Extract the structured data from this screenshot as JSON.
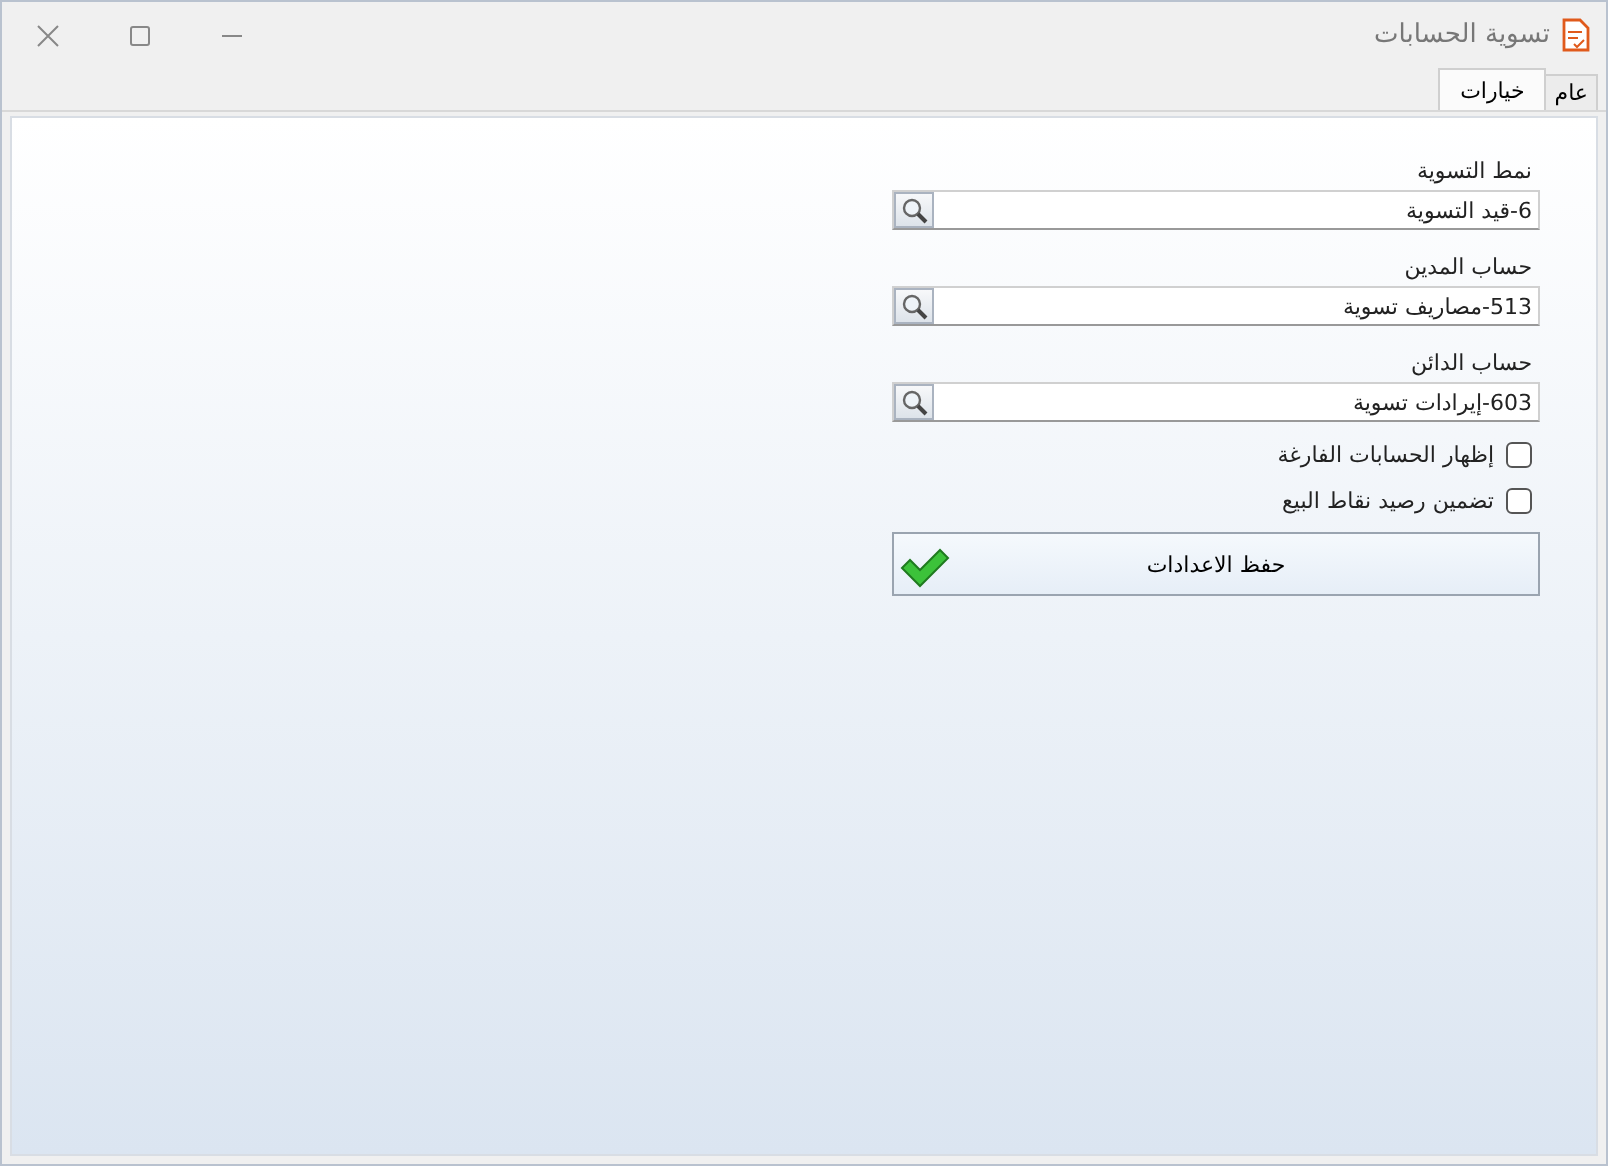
{
  "window": {
    "title": "تسوية الحسابات"
  },
  "tabs": [
    {
      "label": "عام",
      "selected": false
    },
    {
      "label": "خيارات",
      "selected": true
    }
  ],
  "fields": [
    {
      "label": "نمط التسوية",
      "value": "6-قيد التسوية"
    },
    {
      "label": "حساب المدين",
      "value": "513-مصاريف تسوية"
    },
    {
      "label": "حساب الدائن",
      "value": "603-إيرادات تسوية"
    }
  ],
  "checkboxes": [
    {
      "label": "إظهار الحسابات الفارغة",
      "checked": false
    },
    {
      "label": "تضمين رصيد نقاط البيع",
      "checked": false
    }
  ],
  "save_button": {
    "label": "حفظ الاعدادات"
  }
}
